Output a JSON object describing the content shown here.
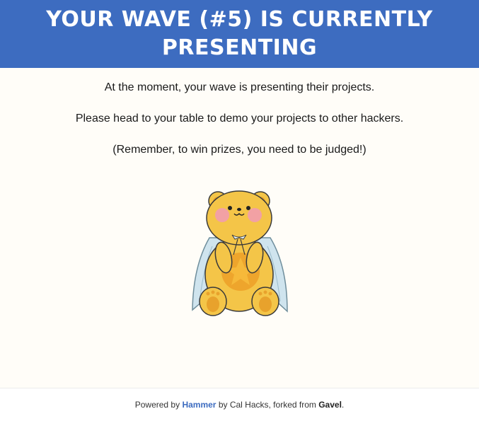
{
  "banner": {
    "title": "YOUR WAVE (#5) IS CURRENTLY PRESENTING",
    "color": "#3d6cc0"
  },
  "messages": {
    "line1": "At the moment, your wave is presenting their projects.",
    "line2": "Please head to your table to demo your projects to other hackers.",
    "line3": "(Remember, to win prizes, you need to be judged!)"
  },
  "mascot": {
    "icon": "bear-mascot-icon"
  },
  "footer": {
    "powered_by": "Powered by",
    "hammer_link": "Hammer",
    "by_text": "by Cal Hacks, forked from",
    "gavel": "Gavel",
    "period": "."
  }
}
